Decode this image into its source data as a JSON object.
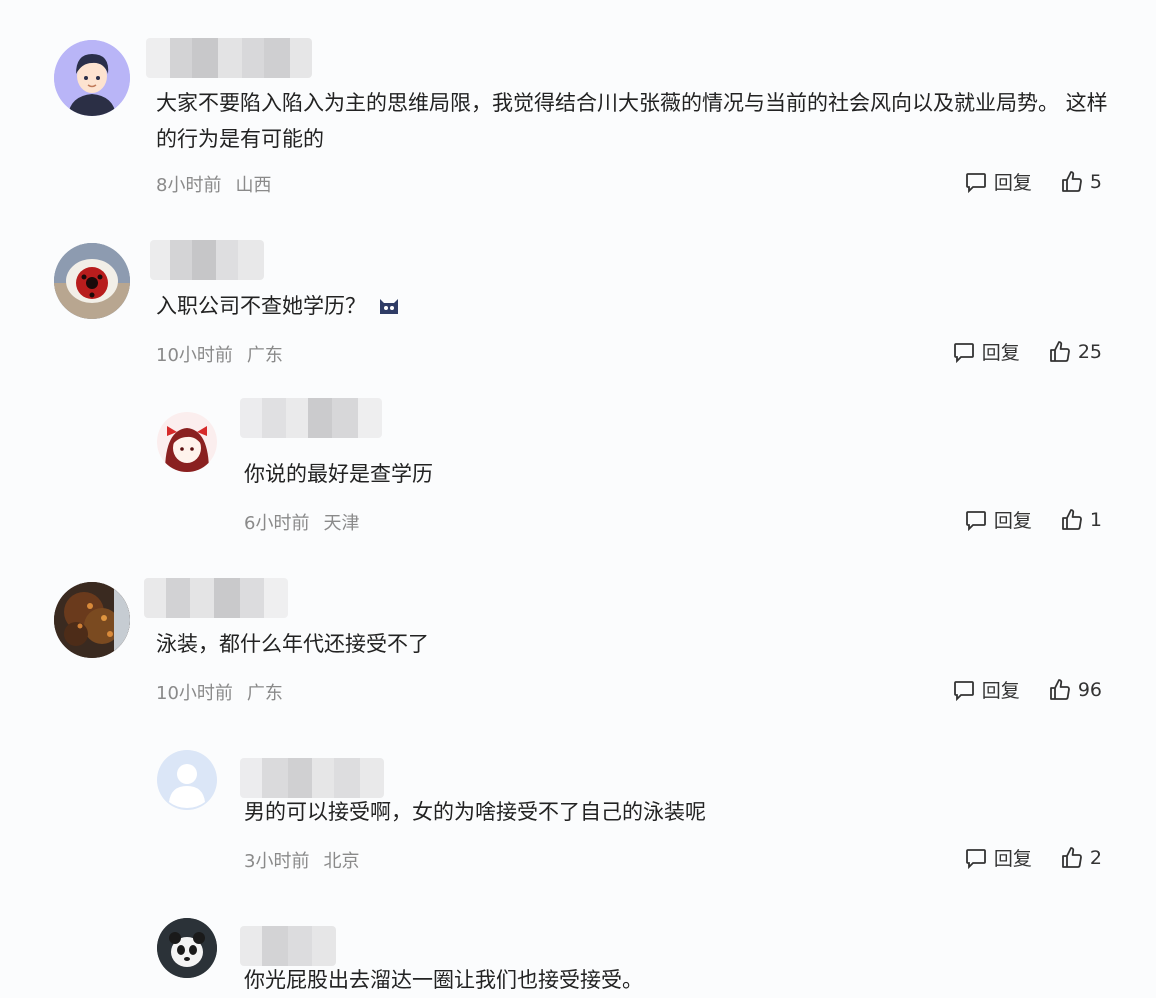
{
  "comments": [
    {
      "text": "大家不要陷入陷入为主的思维局限，我觉得结合川大张薇的情况与当前的社会风向以及就业局势。 这样的行为是有可能的",
      "time": "8小时前",
      "location": "山西",
      "reply_label": "回复",
      "likes": "5"
    },
    {
      "text": "入职公司不查她学历？",
      "time": "10小时前",
      "location": "广东",
      "reply_label": "回复",
      "likes": "25"
    },
    {
      "text": "你说的最好是查学历",
      "time": "6小时前",
      "location": "天津",
      "reply_label": "回复",
      "likes": "1"
    },
    {
      "text": "泳装，都什么年代还接受不了",
      "time": "10小时前",
      "location": "广东",
      "reply_label": "回复",
      "likes": "96"
    },
    {
      "text": "男的可以接受啊，女的为啥接受不了自己的泳装呢",
      "time": "3小时前",
      "location": "北京",
      "reply_label": "回复",
      "likes": "2"
    },
    {
      "text": "你光屁股出去溜达一圈让我们也接受接受。",
      "time": "",
      "location": "",
      "reply_label": "",
      "likes": ""
    }
  ],
  "icons": {
    "reply": "comment-bubble-icon",
    "like": "thumbs-up-icon",
    "emoji": "cat-face-emoji-icon"
  }
}
